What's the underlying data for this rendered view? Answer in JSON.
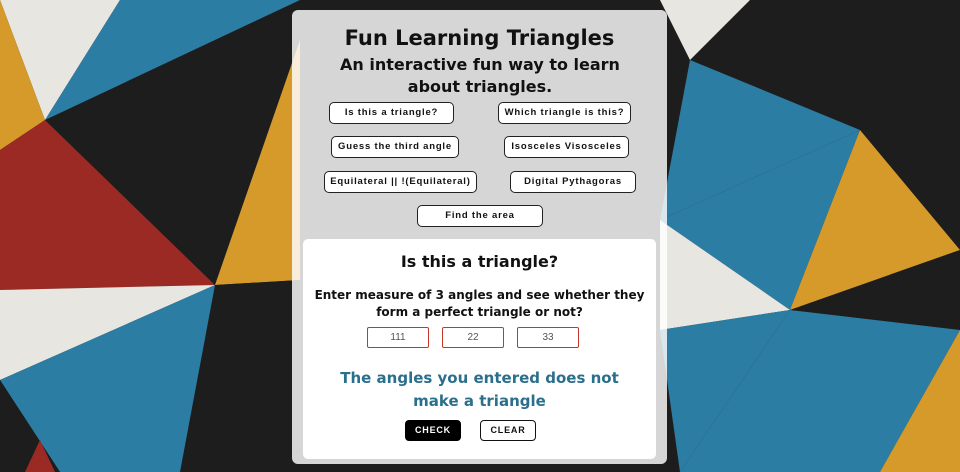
{
  "header": {
    "title": "Fun Learning Triangles",
    "subtitle": "An interactive fun way to learn about triangles."
  },
  "nav": {
    "items": [
      {
        "label": "Is this a triangle?"
      },
      {
        "label": "Which triangle is this?"
      },
      {
        "label": "Guess the third angle"
      },
      {
        "label": "Isosceles Visosceles"
      },
      {
        "label": "Equilateral || !(Equilateral)"
      },
      {
        "label": "Digital Pythagoras"
      },
      {
        "label": "Find the area"
      }
    ]
  },
  "panel": {
    "title": "Is this a triangle?",
    "instruction": "Enter measure of 3 angles and see whether they form a perfect triangle or not?",
    "inputs": [
      "111",
      "22",
      "33"
    ],
    "result": "The angles you entered does not make a triangle",
    "check_label": "CHECK",
    "clear_label": "CLEAR"
  },
  "colors": {
    "background_red": "#9b2a25",
    "background_blue": "#2c7da3",
    "background_yellow": "#d59a2a",
    "background_dark": "#1d1d1d",
    "result_text": "#2a6f8c"
  }
}
